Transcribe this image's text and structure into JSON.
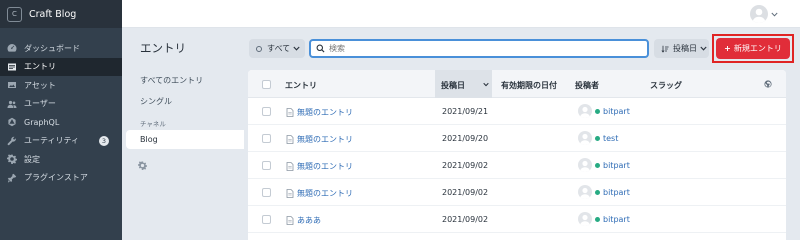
{
  "app": {
    "logo_letter": "C",
    "site_name": "Craft Blog"
  },
  "nav": [
    {
      "label": "ダッシュボード",
      "icon": "dashboard-icon"
    },
    {
      "label": "エントリ",
      "icon": "entries-icon",
      "active": true
    },
    {
      "label": "アセット",
      "icon": "assets-icon"
    },
    {
      "label": "ユーザー",
      "icon": "users-icon"
    },
    {
      "label": "GraphQL",
      "icon": "graphql-icon"
    },
    {
      "label": "ユーティリティ",
      "icon": "utilities-icon",
      "badge": "3"
    },
    {
      "label": "設定",
      "icon": "settings-icon"
    },
    {
      "label": "プラグインストア",
      "icon": "plugin-store-icon"
    }
  ],
  "page": {
    "title": "エントリ"
  },
  "sources": {
    "all": "すべてのエントリ",
    "singles": "シングル",
    "heading": "チャネル",
    "active": "Blog"
  },
  "toolbar": {
    "status_filter": "すべて",
    "search_placeholder": "検索",
    "sort_label": "投稿日",
    "new_entry": "新規エントリ"
  },
  "table": {
    "headers": {
      "title": "エントリ",
      "post_date": "投稿日",
      "expiry": "有効期限の日付",
      "author": "投稿者",
      "slug": "スラッグ"
    },
    "rows": [
      {
        "title": "無題のエントリ",
        "date": "2021/09/21",
        "author": "bitpart"
      },
      {
        "title": "無題のエントリ",
        "date": "2021/09/20",
        "author": "test"
      },
      {
        "title": "無題のエントリ",
        "date": "2021/09/02",
        "author": "bitpart"
      },
      {
        "title": "無題のエントリ",
        "date": "2021/09/02",
        "author": "bitpart"
      },
      {
        "title": "あああ",
        "date": "2021/09/02",
        "author": "bitpart"
      }
    ]
  },
  "colors": {
    "accent_red": "#e12d39",
    "link": "#2f6cb5",
    "status_live": "#27ab83",
    "sidebar": "#33404d"
  }
}
